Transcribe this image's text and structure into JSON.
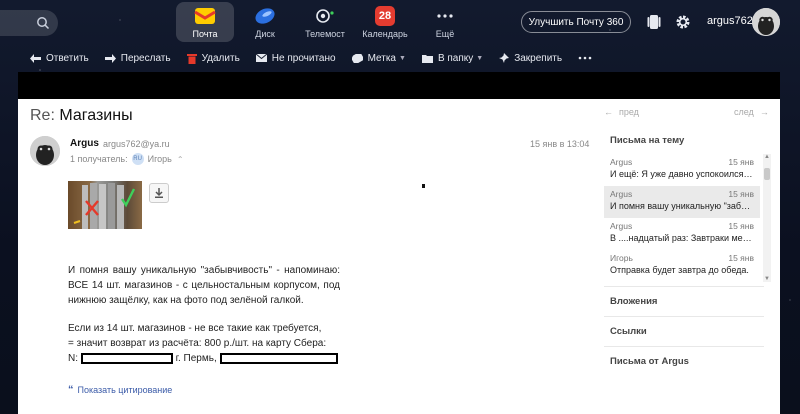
{
  "topbar": {
    "services": [
      {
        "label": "Почта",
        "icon": "mail-icon"
      },
      {
        "label": "Диск",
        "icon": "disk-icon"
      },
      {
        "label": "Телемост",
        "icon": "telemost-icon"
      },
      {
        "label": "Календарь",
        "icon": "calendar-icon",
        "badge": "28"
      },
      {
        "label": "Ещё",
        "icon": "more-dots-icon"
      }
    ],
    "upgrade_label": "Улучшить Почту 360",
    "username": "argus762"
  },
  "toolbar": {
    "reply": "Ответить",
    "forward": "Переслать",
    "delete": "Удалить",
    "unread": "Не прочитано",
    "label": "Метка",
    "to_folder": "В папку",
    "pin": "Закрепить"
  },
  "message": {
    "subject_prefix": "Re:",
    "subject": "Магазины",
    "sender_name": "Argus",
    "sender_email": "argus762@ya.ru",
    "recipients_label": "1 получатель:",
    "recipient_badge": "RU",
    "recipient_name": "Игорь",
    "date": "15 янв в 13:04",
    "paragraph1": "И помня вашу уникальную \"забывчивость\" - напоминаю: ВСЕ 14 шт. магазинов - с цельностальным корпусом, под нижнюю защёлку, как на фото под зелёной галкой.",
    "paragraph2_line1": "Если из 14 шт. магазинов - не все такие как требуется,",
    "paragraph2_line2": "= значит возврат из расчёта: 800 р./шт. на карту Сбера:",
    "paragraph2_prefix": "N:",
    "paragraph2_city": "г. Пермь,",
    "show_quote": "Показать цитирование"
  },
  "sidebar": {
    "prev": "пред",
    "next": "след",
    "thread_title": "Письма на тему",
    "threads": [
      {
        "author": "Argus",
        "date": "15 янв",
        "snippet": "И ещё: Я уже давно успокоился, т..."
      },
      {
        "author": "Argus",
        "date": "15 янв",
        "snippet": "И помня вашу уникальную \"забыв..."
      },
      {
        "author": "Argus",
        "date": "15 янв",
        "snippet": "В ....надцатый раз: Завтраки мен..."
      },
      {
        "author": "Игорь",
        "date": "15 янв",
        "snippet": "Отправка будет завтра до обеда."
      }
    ],
    "attachments": "Вложения",
    "links": "Ссылки",
    "from_sender": "Письма от Argus"
  }
}
